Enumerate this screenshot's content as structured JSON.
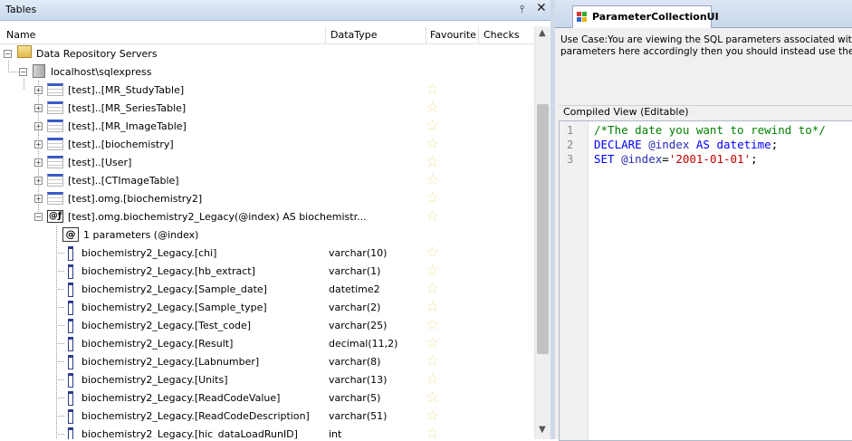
{
  "left_panel": {
    "title": "Tables",
    "pin_icon": "pin-icon",
    "close_icon": "close-icon"
  },
  "columns": {
    "name": "Name",
    "datatype": "DataType",
    "favourite": "Favourite",
    "checks": "Checks"
  },
  "tree": {
    "root": "Data Repository Servers",
    "server": "localhost\\sqlexpress",
    "tables": [
      "[test]..[MR_StudyTable]",
      "[test]..[MR_SeriesTable]",
      "[test]..[MR_ImageTable]",
      "[test]..[biochemistry]",
      "[test]..[User]",
      "[test]..[CTImageTable]",
      "[test].omg.[biochemistry2]"
    ],
    "tvf": "[test].omg.biochemistry2_Legacy(@index) AS biochemistr...",
    "params": "1 parameters (@index)",
    "param_icon": "@",
    "columns": [
      {
        "name": "biochemistry2_Legacy.[chi]",
        "type": "varchar(10)"
      },
      {
        "name": "biochemistry2_Legacy.[hb_extract]",
        "type": "varchar(1)"
      },
      {
        "name": "biochemistry2_Legacy.[Sample_date]",
        "type": "datetime2"
      },
      {
        "name": "biochemistry2_Legacy.[Sample_type]",
        "type": "varchar(2)"
      },
      {
        "name": "biochemistry2_Legacy.[Test_code]",
        "type": "varchar(25)"
      },
      {
        "name": "biochemistry2_Legacy.[Result]",
        "type": "decimal(11,2)"
      },
      {
        "name": "biochemistry2_Legacy.[Labnumber]",
        "type": "varchar(8)"
      },
      {
        "name": "biochemistry2_Legacy.[Units]",
        "type": "varchar(13)"
      },
      {
        "name": "biochemistry2_Legacy.[ReadCodeValue]",
        "type": "varchar(5)"
      },
      {
        "name": "biochemistry2_Legacy.[ReadCodeDescription]",
        "type": "varchar(51)"
      },
      {
        "name": "biochemistry2_Legacy.[hic_dataLoadRunID]",
        "type": "int"
      }
    ]
  },
  "right_panel": {
    "tab": "ParameterCollectionUI",
    "usecase_line1": "Use Case:You are viewing the SQL parameters associated with a Ta",
    "usecase_line2": "parameters here accordingly then you should instead use the \"Synchr",
    "group_label": "Compiled View (Editable)",
    "code": {
      "line1": "/*The date you want to rewind to*/",
      "line2_kw": "DECLARE",
      "line2_var": "@index",
      "line2_as": "AS",
      "line2_type": "datetime",
      "line2_end": ";",
      "line3_kw": "SET",
      "line3_var": "@index",
      "line3_eq": "=",
      "line3_str": "'2001-01-01'",
      "line3_end": ";",
      "ln": [
        "1",
        "2",
        "3"
      ]
    }
  },
  "colors": {
    "comment": "#008000",
    "keyword": "#0000ff",
    "string": "#c00000",
    "star": "#f2e4a6"
  }
}
